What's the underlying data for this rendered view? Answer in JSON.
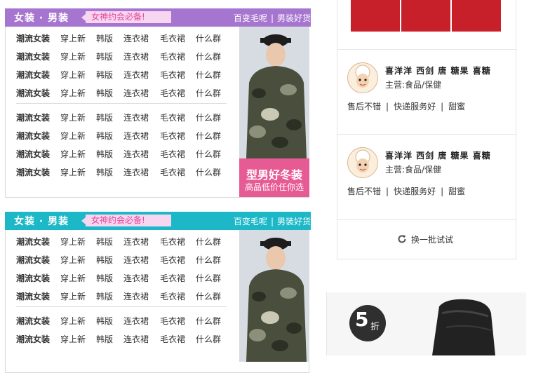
{
  "colors": {
    "panel1_header": "#a675cf",
    "panel2_header": "#1cb8c7",
    "tag_bg": "#f6d6f0",
    "tag_text": "#e8449a",
    "promo_banner": "#e75b95"
  },
  "panels": [
    {
      "title": "女装 · 男装",
      "tag": "女神约会必备!",
      "links": [
        "百变毛呢",
        "男装好货"
      ],
      "rows": [
        [
          "潮流女装",
          "穿上新",
          "韩版",
          "连衣裙",
          "毛衣裙",
          "什么群"
        ],
        [
          "潮流女装",
          "穿上新",
          "韩版",
          "连衣裙",
          "毛衣裙",
          "什么群"
        ],
        [
          "潮流女装",
          "穿上新",
          "韩版",
          "连衣裙",
          "毛衣裙",
          "什么群"
        ],
        [
          "潮流女装",
          "穿上新",
          "韩版",
          "连衣裙",
          "毛衣裙",
          "什么群"
        ],
        [
          "潮流女装",
          "穿上新",
          "韩版",
          "连衣裙",
          "毛衣裙",
          "什么群"
        ],
        [
          "潮流女装",
          "穿上新",
          "韩版",
          "连衣裙",
          "毛衣裙",
          "什么群"
        ],
        [
          "潮流女装",
          "穿上新",
          "韩版",
          "连衣裙",
          "毛衣裙",
          "什么群"
        ],
        [
          "潮流女装",
          "穿上新",
          "韩版",
          "连衣裙",
          "毛衣裙",
          "什么群"
        ]
      ],
      "promo_title": "型男好冬装",
      "promo_sub": "高品低价任你选"
    },
    {
      "title": "女装 · 男装",
      "tag": "女神约会必备!",
      "links": [
        "百变毛呢",
        "男装好货"
      ],
      "rows": [
        [
          "潮流女装",
          "穿上新",
          "韩版",
          "连衣裙",
          "毛衣裙",
          "什么群"
        ],
        [
          "潮流女装",
          "穿上新",
          "韩版",
          "连衣裙",
          "毛衣裙",
          "什么群"
        ],
        [
          "潮流女装",
          "穿上新",
          "韩版",
          "连衣裙",
          "毛衣裙",
          "什么群"
        ],
        [
          "潮流女装",
          "穿上新",
          "韩版",
          "连衣裙",
          "毛衣裙",
          "什么群"
        ],
        [
          "潮流女装",
          "穿上新",
          "韩版",
          "连衣裙",
          "毛衣裙",
          "什么群"
        ],
        [
          "潮流女装",
          "穿上新",
          "韩版",
          "连衣裙",
          "毛衣裙",
          "什么群"
        ]
      ]
    }
  ],
  "shops": [
    {
      "name": "喜洋洋 西剑 唐 糖果 喜糖",
      "main": "主营:食品/保健",
      "tags": [
        "售后不错",
        "快递服务好",
        "甜蜜"
      ]
    },
    {
      "name": "喜洋洋 西剑 唐 糖果 喜糖",
      "main": "主营:食品/保健",
      "tags": [
        "售后不错",
        "快递服务好",
        "甜蜜"
      ]
    }
  ],
  "refresh_label": "换一批试试",
  "ad": {
    "discount_num": "5",
    "discount_unit": "折"
  }
}
